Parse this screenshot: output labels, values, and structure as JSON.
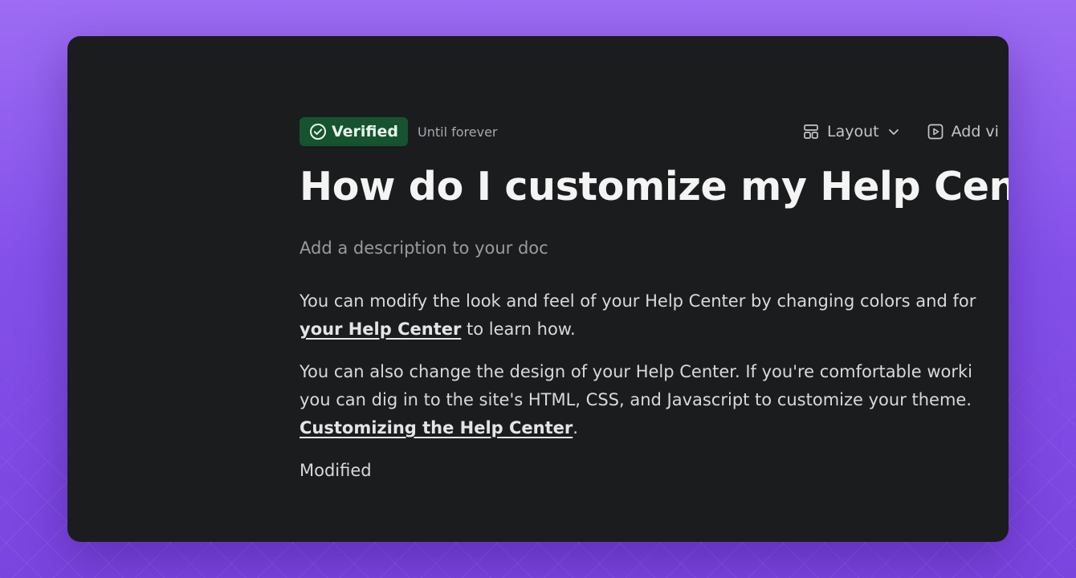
{
  "badge": {
    "label": "Verified",
    "icon": "check-circle-icon",
    "color": "#16532f"
  },
  "verification_period": "Until forever",
  "toolbar": {
    "layout_label": "Layout",
    "layout_icon": "layout-icon",
    "video_label": "Add vi",
    "video_icon": "play-square-icon"
  },
  "doc": {
    "title": "How do I customize my Help Cente",
    "description_placeholder": "Add a description to your doc",
    "paragraphs": [
      {
        "line1": "You can modify the look and feel of your Help Center by changing colors and for",
        "link": "your Help Center",
        "after_link": " to learn how."
      },
      {
        "line1": "You can also change the design of your Help Center. If you're comfortable worki",
        "line2": "you can dig in to the site's HTML, CSS, and Javascript to customize your theme.",
        "link": "Customizing the Help Center",
        "after_link": "."
      },
      {
        "text": "Modified"
      }
    ]
  },
  "colors": {
    "background_accent": "#8a56ec",
    "panel": "#1b1c1d",
    "badge_bg": "#16532f"
  }
}
